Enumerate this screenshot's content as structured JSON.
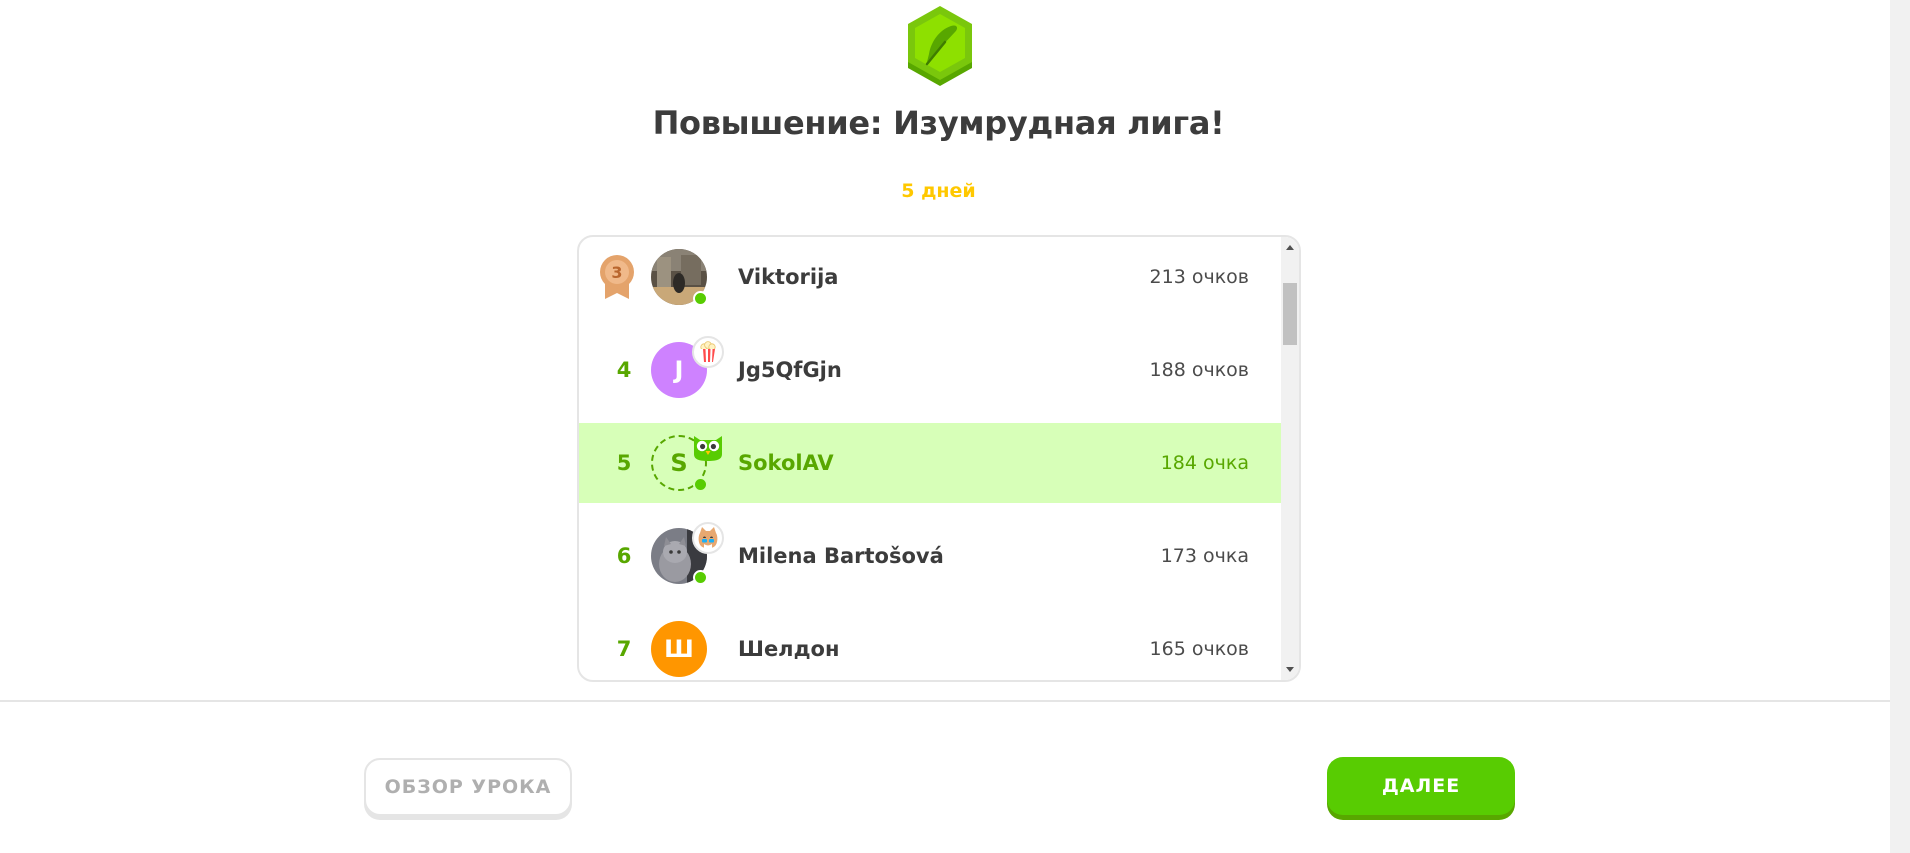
{
  "promotion": {
    "title": "Повышение: Изумрудная лига!",
    "days": "5 дней",
    "badge_icon": "feather-icon",
    "badge_color": "#7ac70c"
  },
  "leaderboard": {
    "rows": [
      {
        "rank": "3",
        "rank_icon": "bronze-medal-icon",
        "name": "Viktorija",
        "points": "213 очков",
        "avatar": "photo",
        "online": true
      },
      {
        "rank": "4",
        "name": "Jg5QfGjn",
        "points": "188 очков",
        "avatar_letter": "J",
        "avatar_color": "#ce82ff",
        "badge_icon": "popcorn-icon"
      },
      {
        "rank": "5",
        "name": "SokolAV",
        "points": "184 очка",
        "avatar_letter": "S",
        "current_user": true,
        "online": true,
        "badge_icon": "duo-owl-icon"
      },
      {
        "rank": "6",
        "name": "Milena Bartošová",
        "points": "173 очка",
        "avatar": "photo",
        "online": true,
        "badge_icon": "cat-icon"
      },
      {
        "rank": "7",
        "name": "Шелдон",
        "points": "165 очков",
        "avatar_letter": "Ш",
        "avatar_color": "#ff9600"
      }
    ]
  },
  "footer": {
    "review_button": "ОБЗОР УРОКА",
    "next_button": "ДАЛЕЕ"
  },
  "colors": {
    "accent_green": "#58cc02",
    "highlight_row": "#d7ffb8",
    "days_yellow": "#ffc800"
  }
}
